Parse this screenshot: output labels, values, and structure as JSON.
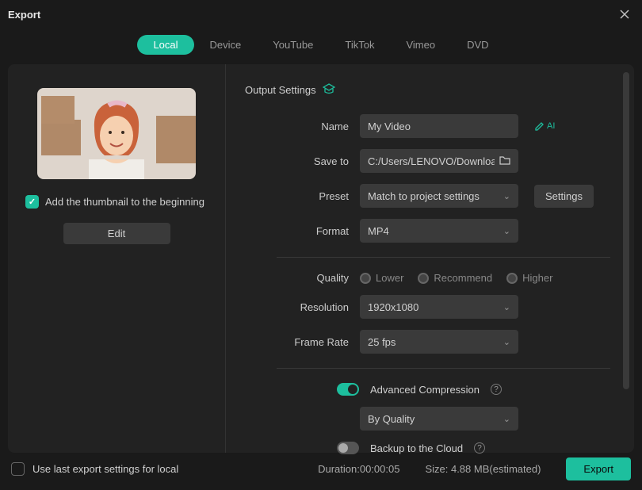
{
  "window": {
    "title": "Export"
  },
  "tabs": [
    "Local",
    "Device",
    "YouTube",
    "TikTok",
    "Vimeo",
    "DVD"
  ],
  "active_tab": 0,
  "left": {
    "checkbox_label": "Add the thumbnail to the beginning",
    "checkbox_checked": true,
    "edit_button": "Edit"
  },
  "output": {
    "section_title": "Output Settings",
    "name_label": "Name",
    "name_value": "My Video",
    "saveto_label": "Save to",
    "saveto_value": "C:/Users/LENOVO/Downloads",
    "preset_label": "Preset",
    "preset_value": "Match to project settings",
    "settings_button": "Settings",
    "format_label": "Format",
    "format_value": "MP4",
    "quality_label": "Quality",
    "quality_options": [
      "Lower",
      "Recommend",
      "Higher"
    ],
    "resolution_label": "Resolution",
    "resolution_value": "1920x1080",
    "framerate_label": "Frame Rate",
    "framerate_value": "25 fps",
    "advcompression_label": "Advanced Compression",
    "advcompression_on": true,
    "compression_mode": "By Quality",
    "backup_label": "Backup to the Cloud",
    "backup_on": false
  },
  "footer": {
    "use_last_label": "Use last export settings for local",
    "use_last_checked": false,
    "duration_label": "Duration:",
    "duration_value": "00:00:05",
    "size_label": "Size: ",
    "size_value": "4.88 MB",
    "size_suffix": "(estimated)",
    "export_button": "Export"
  }
}
